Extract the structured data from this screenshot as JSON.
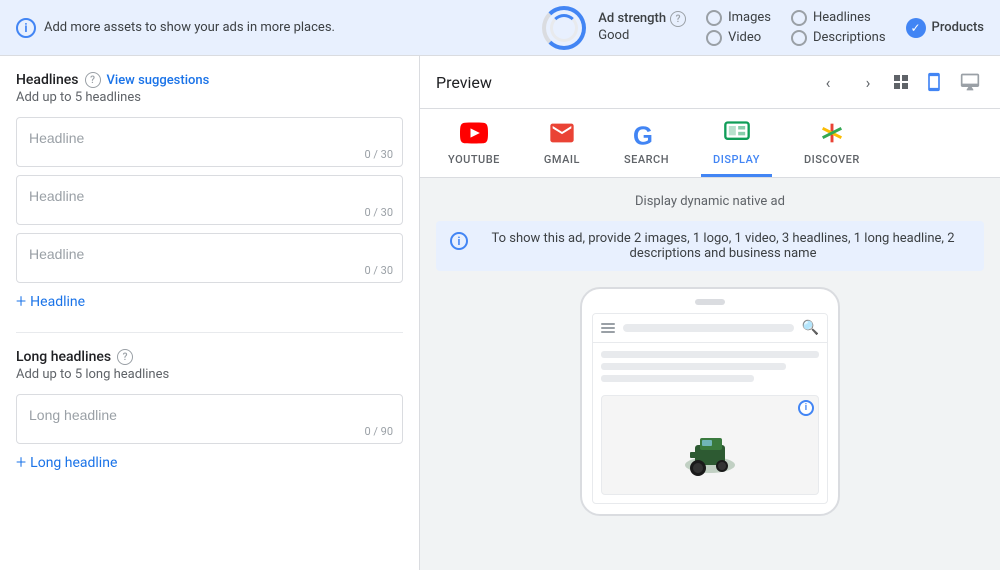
{
  "topbar": {
    "info_message": "Add more assets to show your ads in more places.",
    "ad_strength_label": "Ad strength",
    "ad_strength_help": "?",
    "ad_strength_value": "Good",
    "images_label": "Images",
    "video_label": "Video",
    "headlines_label": "Headlines",
    "descriptions_label": "Descriptions",
    "products_label": "Products"
  },
  "left_panel": {
    "headlines_title": "Headlines",
    "headlines_help": "?",
    "view_suggestions": "View suggestions",
    "headlines_subtitle": "Add up to 5 headlines",
    "headline_placeholder": "Headline",
    "headline_char_count": "0 / 30",
    "add_headline_label": "Headline",
    "long_headlines_title": "Long headlines",
    "long_headlines_help": "?",
    "long_headlines_subtitle": "Add up to 5 long headlines",
    "long_headline_placeholder": "Long headline",
    "long_headline_char_count": "0 / 90",
    "add_long_headline_label": "Long headline"
  },
  "right_panel": {
    "preview_title": "Preview",
    "platforms": [
      {
        "id": "youtube",
        "label": "YOUTUBE",
        "active": false
      },
      {
        "id": "gmail",
        "label": "GMAIL",
        "active": false
      },
      {
        "id": "search",
        "label": "SEARCH",
        "active": false
      },
      {
        "id": "display",
        "label": "DISPLAY",
        "active": true
      },
      {
        "id": "discover",
        "label": "DISCOVER",
        "active": false
      }
    ],
    "display_label": "Display dynamic native ad",
    "info_text": "To show this ad, provide 2 images, 1 logo, 1 video, 3 headlines, 1 long headline, 2 descriptions and business name"
  }
}
